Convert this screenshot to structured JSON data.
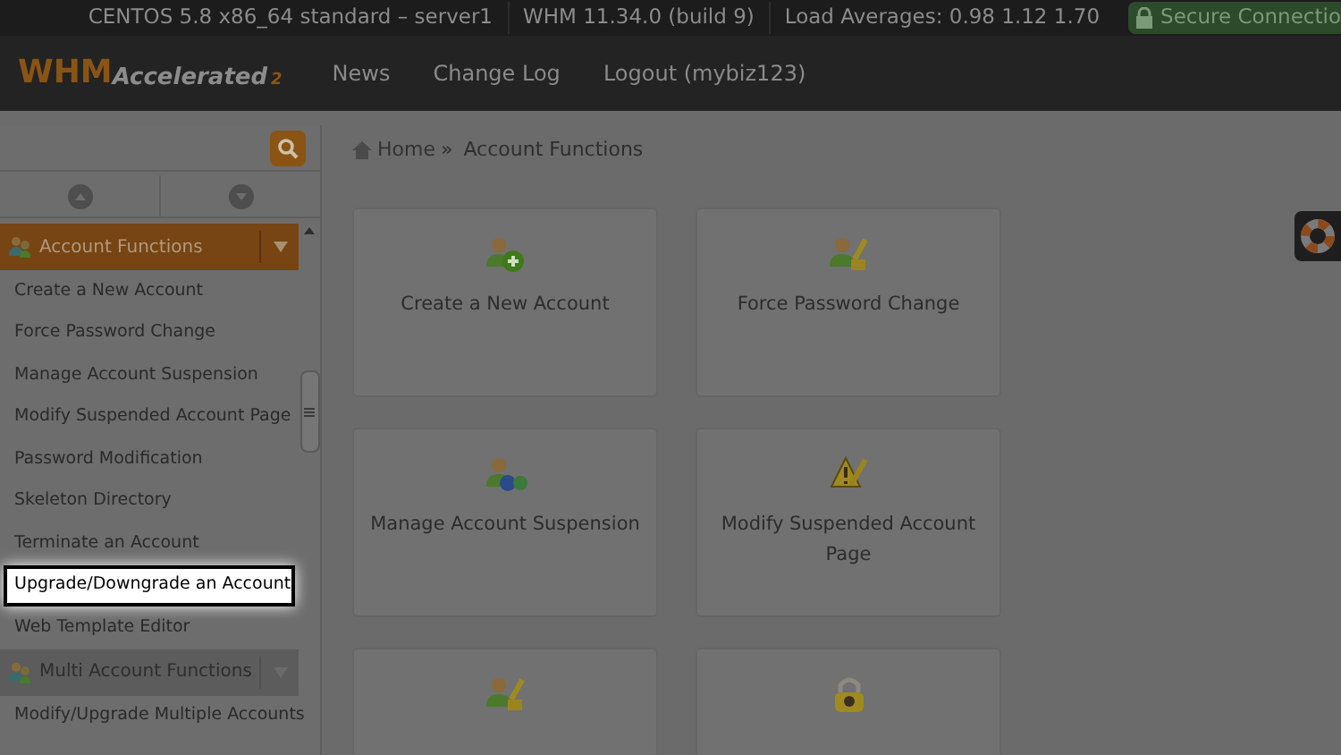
{
  "status_bar": {
    "server": "CENTOS 5.8 x86_64 standard – server1",
    "version": "WHM 11.34.0 (build 9)",
    "load": "Load Averages: 0.98 1.12 1.70",
    "secure": "Secure Connectio"
  },
  "header": {
    "logo_main": "WHM",
    "logo_sub": "Accelerated",
    "logo_num": "2",
    "nav": [
      "News",
      "Change Log",
      "Logout (mybiz123)"
    ]
  },
  "sidebar": {
    "groups": [
      {
        "label": "Account Functions",
        "active": true,
        "items": [
          {
            "label": "Create a New Account",
            "highlighted": false
          },
          {
            "label": "Force Password Change",
            "highlighted": false
          },
          {
            "label": "Manage Account Suspension",
            "highlighted": false
          },
          {
            "label": "Modify Suspended Account Page",
            "highlighted": false
          },
          {
            "label": "Password Modification",
            "highlighted": false
          },
          {
            "label": "Skeleton Directory",
            "highlighted": false
          },
          {
            "label": "Terminate an Account",
            "highlighted": false
          },
          {
            "label": "Upgrade/Downgrade an Account",
            "highlighted": true
          },
          {
            "label": "Web Template Editor",
            "highlighted": false
          }
        ]
      },
      {
        "label": "Multi Account Functions",
        "active": false,
        "items": [
          {
            "label": "Modify/Upgrade Multiple Accounts",
            "highlighted": false
          }
        ]
      }
    ]
  },
  "breadcrumb": {
    "home": "Home",
    "separator": "»",
    "current": "Account Functions"
  },
  "cards": [
    {
      "label": "Create a New Account",
      "kind": "user-add"
    },
    {
      "label": "Force Password Change",
      "kind": "user-key"
    },
    {
      "label": "Manage Account Suspension",
      "kind": "user-pause"
    },
    {
      "label": "Modify Suspended Account Page",
      "kind": "warning-edit"
    },
    {
      "kind": "user-key"
    },
    {
      "kind": "lock-skull"
    }
  ]
}
